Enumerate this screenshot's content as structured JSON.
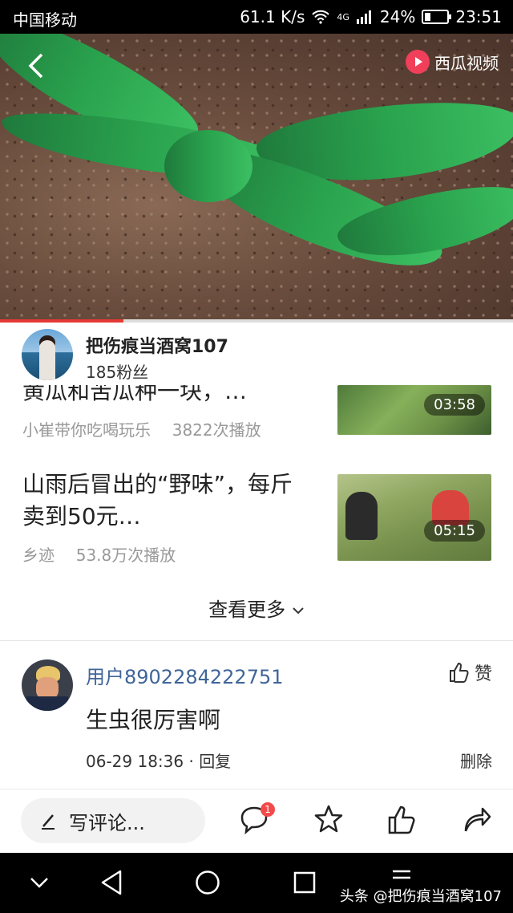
{
  "status_bar": {
    "carrier": "中国移动",
    "speed": "61.1 K/s",
    "network": "4G",
    "battery": "24%",
    "time": "23:51"
  },
  "video": {
    "brand": "西瓜视频",
    "progress": 0.24,
    "colors": {
      "progress": "#e53935",
      "leaf": "#2aa34e"
    }
  },
  "author": {
    "name": "把伤痕当酒窝107",
    "fans": "185粉丝"
  },
  "related": [
    {
      "title": "黄瓜和苦瓜种一块，…",
      "source": "小崔带你吃喝玩乐",
      "plays": "3822次播放",
      "duration": "03:58"
    },
    {
      "title": "山雨后冒出的“野味”，每斤卖到50元…",
      "source": "乡迹",
      "plays": "53.8万次播放",
      "duration": "05:15"
    }
  ],
  "see_more": "查看更多",
  "comment": {
    "user": "用户8902284222751",
    "like_label": "赞",
    "text": "生虫很厉害啊",
    "time": "06-29 18:36",
    "reply_label": "回复",
    "delete_label": "删除"
  },
  "bottom_bar": {
    "comment_placeholder": "写评论...",
    "comment_count_badge": "1"
  },
  "watermark": "头条 @把伤痕当酒窝107",
  "accent_link_color": "#406599"
}
